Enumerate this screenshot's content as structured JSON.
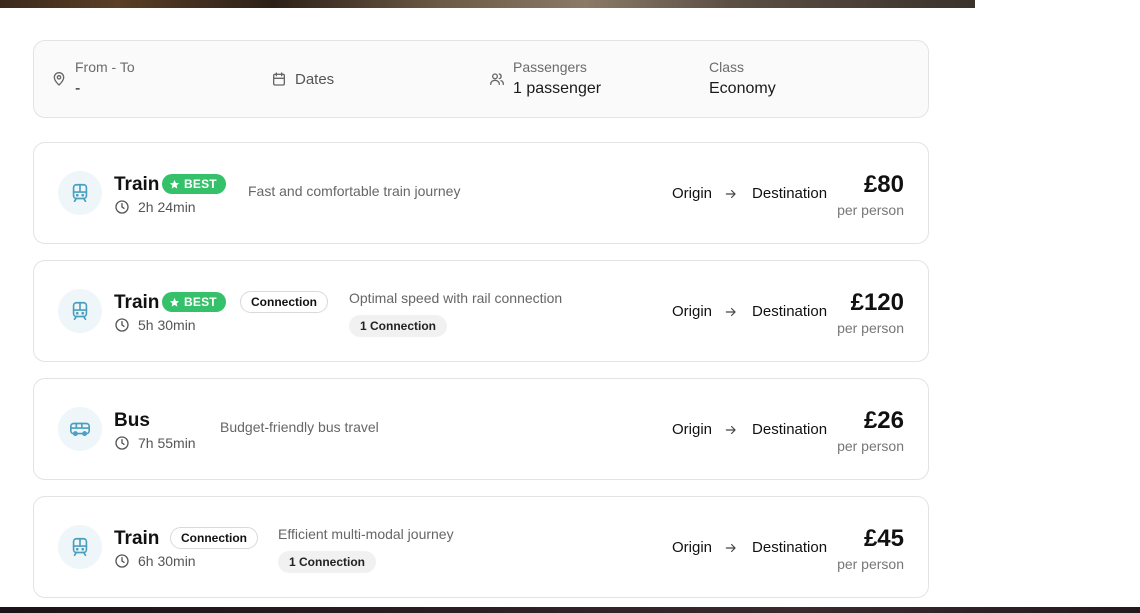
{
  "search": {
    "from_to": {
      "label": "From - To",
      "value": "-"
    },
    "dates": {
      "label": "Dates"
    },
    "passengers": {
      "label": "Passengers",
      "value": "1 passenger"
    },
    "class": {
      "label": "Class",
      "value": "Economy"
    }
  },
  "colors": {
    "best_badge": "#35c16a",
    "mode_icon": "#4a9fbf",
    "mode_icon_bg": "#eef6f9"
  },
  "results": [
    {
      "mode": "Train",
      "icon": "train-icon",
      "best_label": "BEST",
      "connection_badge": "",
      "duration": "2h 24min",
      "description": "Fast and comfortable train journey",
      "connection_chip": "",
      "origin": "Origin",
      "destination": "Destination",
      "price": "£80",
      "per_person": "per person"
    },
    {
      "mode": "Train",
      "icon": "train-icon",
      "best_label": "BEST",
      "connection_badge": "Connection",
      "duration": "5h 30min",
      "description": "Optimal speed with rail connection",
      "connection_chip": "1 Connection",
      "origin": "Origin",
      "destination": "Destination",
      "price": "£120",
      "per_person": "per person"
    },
    {
      "mode": "Bus",
      "icon": "bus-icon",
      "best_label": "",
      "connection_badge": "",
      "duration": "7h 55min",
      "description": "Budget-friendly bus travel",
      "connection_chip": "",
      "origin": "Origin",
      "destination": "Destination",
      "price": "£26",
      "per_person": "per person"
    },
    {
      "mode": "Train",
      "icon": "train-icon",
      "best_label": "",
      "connection_badge": "Connection",
      "duration": "6h 30min",
      "description": "Efficient multi-modal journey",
      "connection_chip": "1 Connection",
      "origin": "Origin",
      "destination": "Destination",
      "price": "£45",
      "per_person": "per person"
    }
  ]
}
